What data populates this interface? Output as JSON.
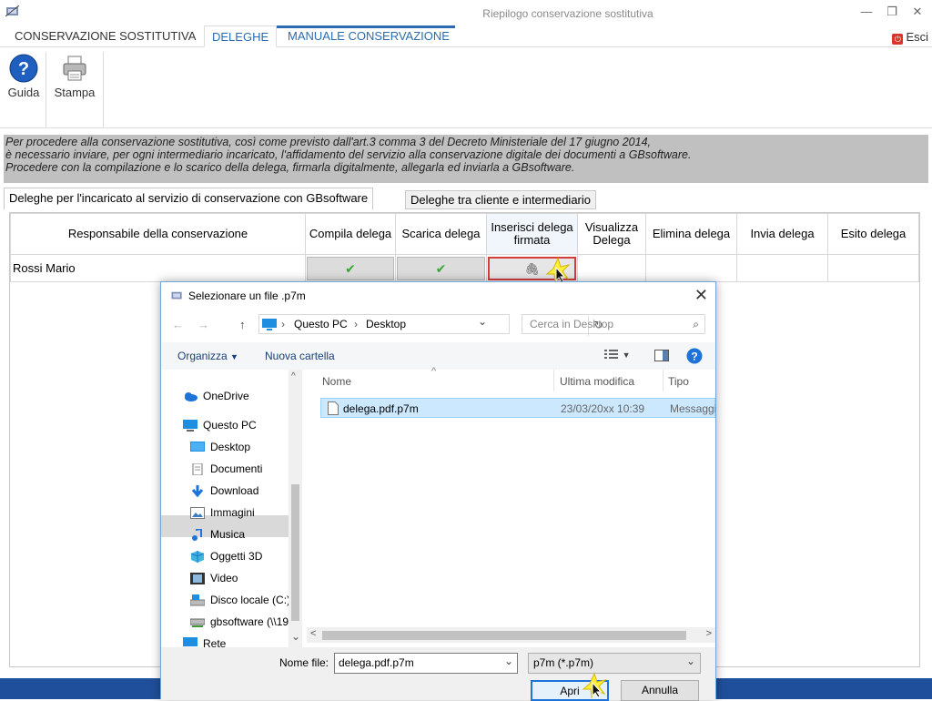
{
  "window": {
    "title": "Riepilogo conservazione sostitutiva",
    "minimize": "—",
    "maximize": "❐",
    "close": "✕"
  },
  "tabs": [
    {
      "label": "CONSERVAZIONE SOSTITUTIVA"
    },
    {
      "label": "DELEGHE"
    },
    {
      "label": "MANUALE CONSERVAZIONE"
    }
  ],
  "exit": {
    "label": "Esci"
  },
  "ribbon": {
    "guida": "Guida",
    "stampa": "Stampa"
  },
  "info": {
    "lines": [
      "Per procedere alla conservazione sostitutiva, così come previsto dall'art.3 comma 3 del Decreto Ministeriale del 17 giugno 2014,",
      "è necessario inviare, per ogni intermediario incaricato, l'affidamento del servizio alla conservazione digitale dei documenti a GBsoftware.",
      "Procedere con la compilazione e lo scarico della delega, firmarla digitalmente, allegarla ed inviarla a GBsoftware."
    ]
  },
  "content_tabs": {
    "tab1": "Deleghe per l'incaricato al servizio di conservazione con GBsoftware",
    "tab2": "Deleghe tra cliente e intermediario"
  },
  "grid": {
    "headers": {
      "responsabile": "Responsabile della conservazione",
      "compila": "Compila delega",
      "scarica": "Scarica delega",
      "inserisci": "Inserisci delega firmata",
      "visualizza": "Visualizza Delega",
      "elimina": "Elimina delega",
      "invia": "Invia delega",
      "esito": "Esito delega"
    },
    "row": {
      "name": "Rossi Mario",
      "check": "✔",
      "attach": "🖇"
    }
  },
  "dialog": {
    "title": "Selezionare un file .p7m",
    "close": "✕",
    "back": "←",
    "forward": "→",
    "up": "↑",
    "address": {
      "part1": "Questo PC",
      "sep": "›",
      "part2": "Desktop",
      "dropdown": "⌄",
      "refresh": "↻"
    },
    "search": {
      "placeholder": "Cerca in Desktop",
      "icon": "⌕"
    },
    "toolbar": {
      "organizza": "Organizza",
      "organizza_arrow": "▼",
      "nuova_cartella": "Nuova cartella",
      "view_arrow": "▼",
      "help": "?"
    },
    "nav": [
      {
        "label": "OneDrive"
      },
      {
        "label": "Questo PC"
      },
      {
        "label": "Desktop"
      },
      {
        "label": "Documenti"
      },
      {
        "label": "Download"
      },
      {
        "label": "Immagini"
      },
      {
        "label": "Musica"
      },
      {
        "label": "Oggetti 3D"
      },
      {
        "label": "Video"
      },
      {
        "label": "Disco locale (C:)"
      },
      {
        "label": "gbsoftware (\\\\19"
      },
      {
        "label": "Rete"
      }
    ],
    "columns": {
      "nome": "Nome",
      "modifica": "Ultima modifica",
      "tipo": "Tipo",
      "sort": "^"
    },
    "file": {
      "name": "delega.pdf.p7m",
      "date": "23/03/20xx 10:39",
      "type": "Messaggi"
    },
    "scroll": {
      "up": "^",
      "down": "⌄",
      "left": "<",
      "right": ">"
    },
    "filename_label": "Nome file:",
    "filename_value": "delega.pdf.p7m",
    "filetype_value": "p7m (*.p7m)",
    "dropdown_arrow": "⌄",
    "open": "Apri",
    "cancel": "Annulla"
  },
  "colors": {
    "accent": "#2b6cb0",
    "highlight": "#d43c3c",
    "selection": "#cce8ff",
    "taskbar": "#1f4f9a"
  }
}
